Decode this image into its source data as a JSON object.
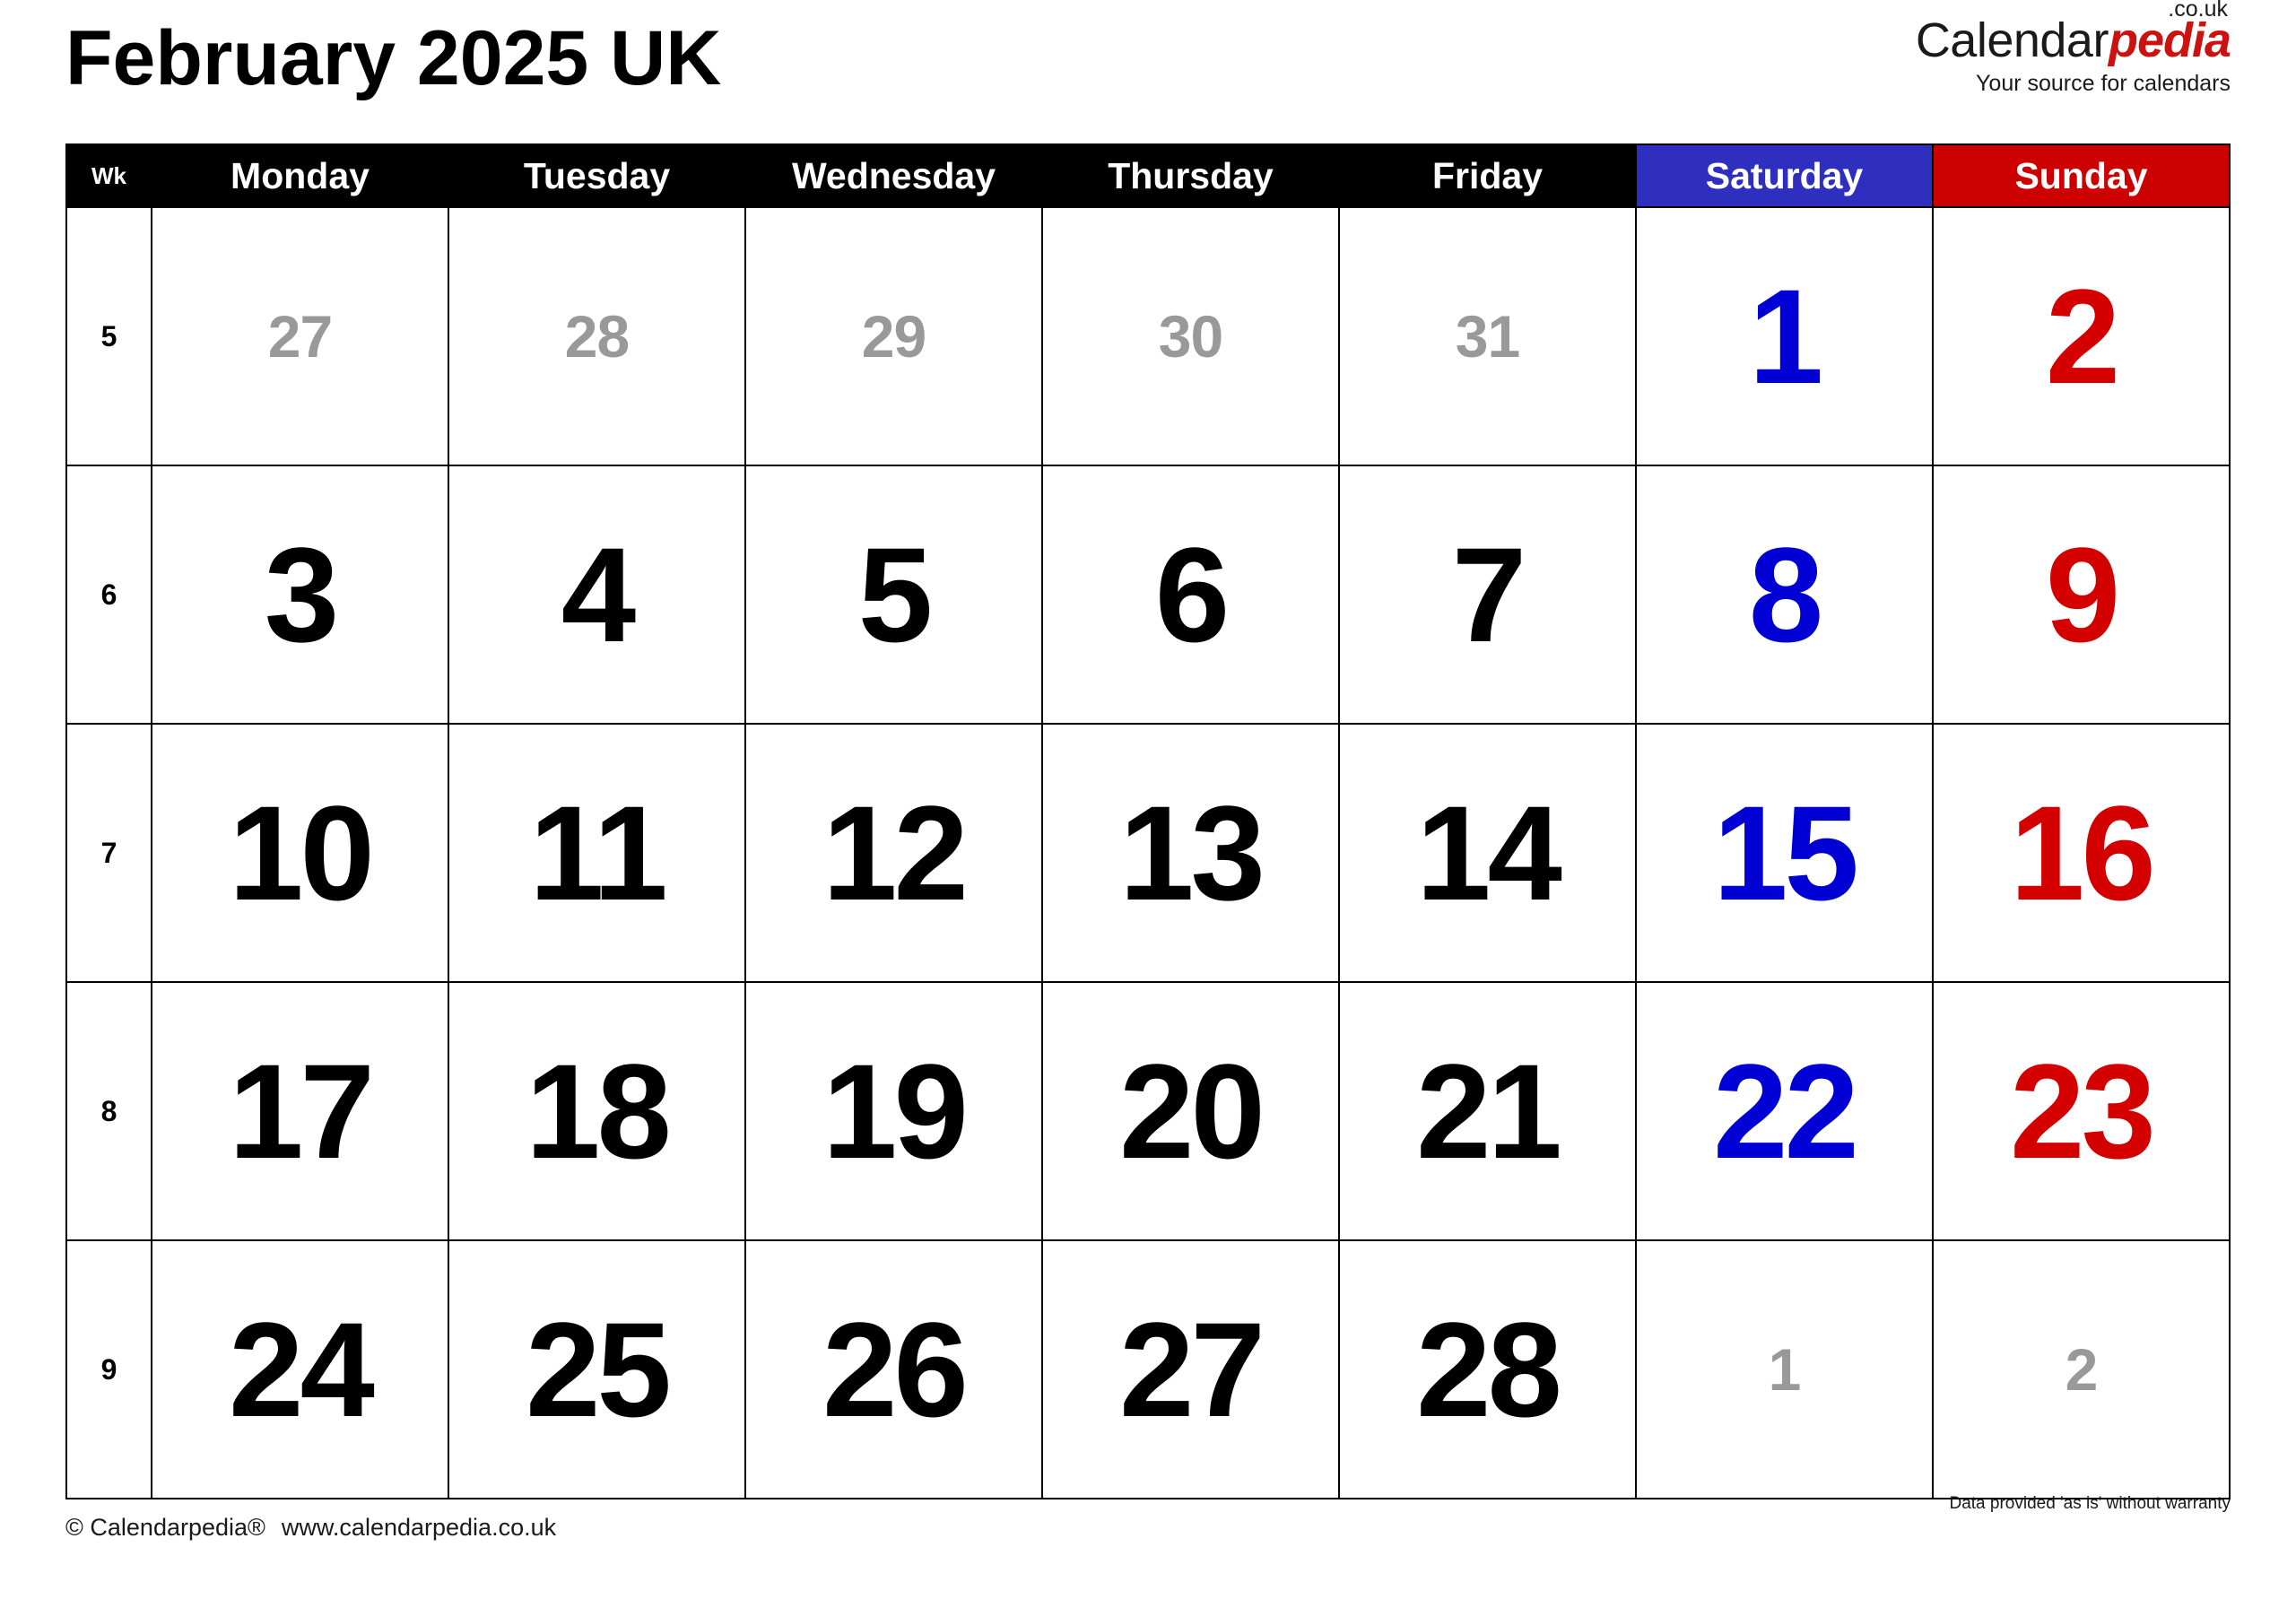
{
  "title": "February 2025 UK",
  "brand": {
    "name_part1": "Calendar",
    "name_part2": "pedia",
    "tld": ".co.uk",
    "tagline": "Your source for calendars",
    "accent_color": "#cc1111"
  },
  "colors": {
    "header_bg": "#000000",
    "saturday_bg": "#2f2fbf",
    "sunday_bg": "#cc0000",
    "saturday_text": "#0000d4",
    "sunday_text": "#d40000",
    "other_month_text": "#999999",
    "grid_line": "#000000"
  },
  "table": {
    "week_header": "Wk",
    "day_headers": [
      "Monday",
      "Tuesday",
      "Wednesday",
      "Thursday",
      "Friday",
      "Saturday",
      "Sunday"
    ],
    "weeks": [
      {
        "week_number": "5",
        "days": [
          {
            "label": "27",
            "type": "other"
          },
          {
            "label": "28",
            "type": "other"
          },
          {
            "label": "29",
            "type": "other"
          },
          {
            "label": "30",
            "type": "other"
          },
          {
            "label": "31",
            "type": "other"
          },
          {
            "label": "1",
            "type": "sat"
          },
          {
            "label": "2",
            "type": "sun"
          }
        ]
      },
      {
        "week_number": "6",
        "days": [
          {
            "label": "3",
            "type": "weekday"
          },
          {
            "label": "4",
            "type": "weekday"
          },
          {
            "label": "5",
            "type": "weekday"
          },
          {
            "label": "6",
            "type": "weekday"
          },
          {
            "label": "7",
            "type": "weekday"
          },
          {
            "label": "8",
            "type": "sat"
          },
          {
            "label": "9",
            "type": "sun"
          }
        ]
      },
      {
        "week_number": "7",
        "days": [
          {
            "label": "10",
            "type": "weekday"
          },
          {
            "label": "11",
            "type": "weekday"
          },
          {
            "label": "12",
            "type": "weekday"
          },
          {
            "label": "13",
            "type": "weekday"
          },
          {
            "label": "14",
            "type": "weekday"
          },
          {
            "label": "15",
            "type": "sat"
          },
          {
            "label": "16",
            "type": "sun"
          }
        ]
      },
      {
        "week_number": "8",
        "days": [
          {
            "label": "17",
            "type": "weekday"
          },
          {
            "label": "18",
            "type": "weekday"
          },
          {
            "label": "19",
            "type": "weekday"
          },
          {
            "label": "20",
            "type": "weekday"
          },
          {
            "label": "21",
            "type": "weekday"
          },
          {
            "label": "22",
            "type": "sat"
          },
          {
            "label": "23",
            "type": "sun"
          }
        ]
      },
      {
        "week_number": "9",
        "days": [
          {
            "label": "24",
            "type": "weekday"
          },
          {
            "label": "25",
            "type": "weekday"
          },
          {
            "label": "26",
            "type": "weekday"
          },
          {
            "label": "27",
            "type": "weekday"
          },
          {
            "label": "28",
            "type": "weekday"
          },
          {
            "label": "1",
            "type": "other"
          },
          {
            "label": "2",
            "type": "other"
          }
        ]
      }
    ]
  },
  "footer": {
    "copyright": "© Calendarpedia®",
    "website": "www.calendarpedia.co.uk",
    "disclaimer": "Data provided 'as is' without warranty"
  }
}
